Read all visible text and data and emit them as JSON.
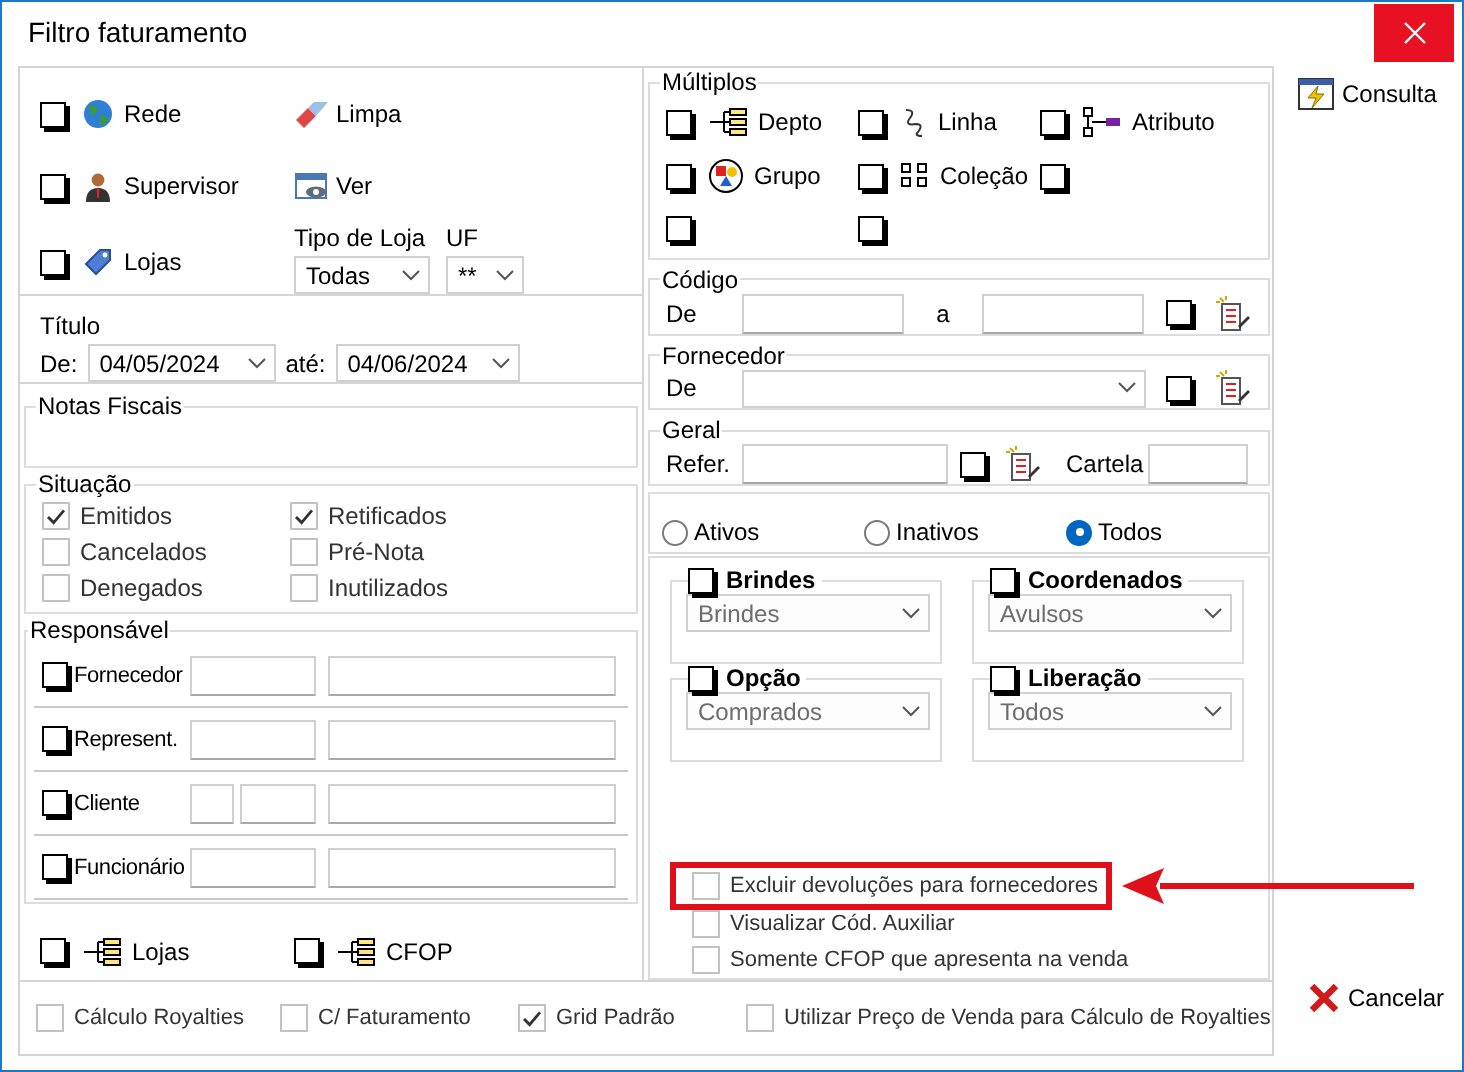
{
  "window": {
    "title": "Filtro faturamento"
  },
  "filters": {
    "items": [
      {
        "label": "Rede",
        "checked": false
      },
      {
        "label": "Supervisor",
        "checked": false
      },
      {
        "label": "Lojas",
        "checked": false
      }
    ],
    "buttons": [
      {
        "label": "Limpa"
      },
      {
        "label": "Ver"
      }
    ],
    "store_type": {
      "label": "Tipo de Loja",
      "value": "Todas"
    },
    "uf": {
      "label": "UF",
      "value": "**"
    }
  },
  "titulo": {
    "title": "Título",
    "from_label": "De:",
    "from": "04/05/2024",
    "to_label": "até:",
    "to": "04/06/2024"
  },
  "notas_fiscais": {
    "title": "Notas Fiscais"
  },
  "situacao": {
    "title": "Situação",
    "options": [
      {
        "label": "Emitidos",
        "checked": true
      },
      {
        "label": "Retificados",
        "checked": true
      },
      {
        "label": "Cancelados",
        "checked": false
      },
      {
        "label": "Pré-Nota",
        "checked": false
      },
      {
        "label": "Denegados",
        "checked": false
      },
      {
        "label": "Inutilizados",
        "checked": false
      }
    ]
  },
  "responsavel": {
    "title": "Responsável",
    "rows": [
      {
        "label": "Fornecedor",
        "checked": false,
        "kind": "two"
      },
      {
        "label": "Represent.",
        "checked": false,
        "kind": "two"
      },
      {
        "label": "Cliente",
        "checked": false,
        "kind": "three"
      },
      {
        "label": "Funcionário",
        "checked": false,
        "kind": "two"
      }
    ]
  },
  "multi_lists": [
    {
      "label": "Lojas",
      "checked": false
    },
    {
      "label": "CFOP",
      "checked": false
    }
  ],
  "multiplos": {
    "title": "Múltiplos",
    "items": [
      {
        "label": "Depto",
        "checked": false
      },
      {
        "label": "Linha",
        "checked": false
      },
      {
        "label": "Atributo",
        "checked": false
      },
      {
        "label": "Grupo",
        "checked": false
      },
      {
        "label": "Coleção",
        "checked": false
      },
      {
        "checked": false
      },
      {
        "checked": false
      },
      {
        "checked": false
      }
    ]
  },
  "codigo": {
    "title": "Código",
    "from_label": "De",
    "to_label": "a",
    "checked": false
  },
  "fornecedor": {
    "title": "Fornecedor",
    "from_label": "De",
    "checked": false
  },
  "geral": {
    "title": "Geral",
    "ref_label": "Refer.",
    "checked": false,
    "cartela_label": "Cartela"
  },
  "status": [
    {
      "label": "Ativos",
      "selected": false
    },
    {
      "label": "Inativos",
      "selected": false
    },
    {
      "label": "Todos",
      "selected": true
    }
  ],
  "groups": [
    {
      "label": "Brindes",
      "checked": false,
      "value": "Brindes"
    },
    {
      "label": "Coordenados",
      "checked": false,
      "value": "Avulsos"
    },
    {
      "label": "Opção",
      "checked": false,
      "value": "Comprados"
    },
    {
      "label": "Liberação",
      "checked": false,
      "value": "Todos"
    }
  ],
  "extra_options": [
    {
      "label": "Excluir devoluções para fornecedores",
      "checked": false,
      "highlighted": true
    },
    {
      "label": "Visualizar Cód. Auxiliar",
      "checked": false,
      "highlighted": false
    },
    {
      "label": "Somente CFOP que apresenta na venda",
      "checked": false,
      "highlighted": false
    }
  ],
  "footer_options": [
    {
      "label": "Cálculo Royalties",
      "checked": false
    },
    {
      "label": "C/ Faturamento",
      "checked": false
    },
    {
      "label": "Grid Padrão",
      "checked": true
    },
    {
      "label": "Utilizar Preço de Venda para Cálculo de Royalties",
      "checked": false
    }
  ],
  "actions": [
    {
      "label": "Consulta"
    },
    {
      "label": "Cancelar"
    }
  ]
}
